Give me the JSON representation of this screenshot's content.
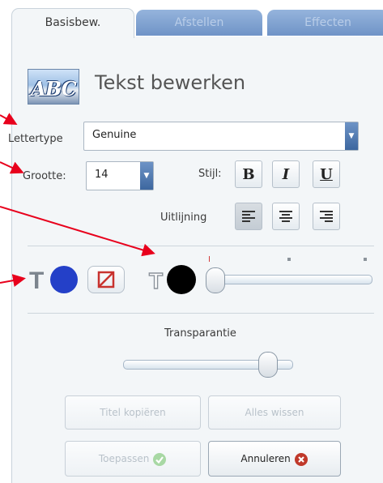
{
  "tabs": [
    "Basisbew.",
    "Afstellen",
    "Effecten"
  ],
  "header": {
    "icon_text": "ABC",
    "title": "Tekst bewerken"
  },
  "font": {
    "label": "Lettertype",
    "value": "Genuine"
  },
  "size": {
    "label": "Grootte:",
    "value": "14"
  },
  "style": {
    "label": "Stijl:",
    "bold": "B",
    "italic": "I",
    "underline": "U"
  },
  "align": {
    "label": "Uitlijning"
  },
  "colors": {
    "text_color": "#2440c8",
    "outline_color": "#000000",
    "no_fill_color": "#c8322e"
  },
  "outline_slider": {
    "level": 0
  },
  "transparency": {
    "label": "Transparantie",
    "level": 0.9
  },
  "buttons": {
    "copy_title": "Titel kopiëren",
    "clear_all": "Alles wissen",
    "apply": "Toepassen",
    "cancel": "Annuleren"
  },
  "annotation_color": "#e8001c"
}
